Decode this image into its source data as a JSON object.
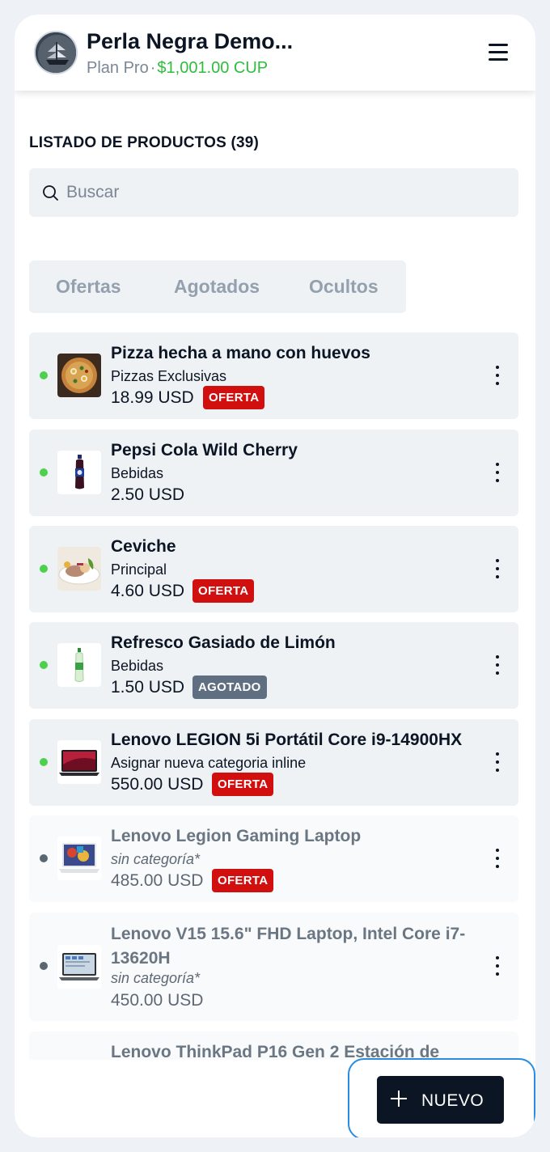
{
  "header": {
    "store_name": "Perla Negra Demo...",
    "plan_name": "Plan Pro",
    "separator": "·",
    "balance": "$1,001.00 CUP",
    "avatar_icon": "pirate-ship-logo",
    "menu_icon": "hamburger-menu-icon"
  },
  "page": {
    "title": "LISTADO DE PRODUCTOS (39)"
  },
  "search": {
    "placeholder": "Buscar",
    "value": "",
    "icon": "search-icon"
  },
  "tabs": [
    {
      "label": "Ofertas"
    },
    {
      "label": "Agotados"
    },
    {
      "label": "Ocultos"
    }
  ],
  "colors": {
    "active_dot": "#4cd14c",
    "inactive_dot": "#5b6673",
    "oferta_badge": "#d10f0f",
    "agotado_badge": "#5f6e81",
    "primary": "#0c1524",
    "balance": "#2ebd3c"
  },
  "products": [
    {
      "name": "Pizza hecha a mano con huevos",
      "category": "Pizzas Exclusivas",
      "price": "18.99 USD",
      "badge": "OFERTA",
      "status": "active",
      "image": "pizza-thumbnail"
    },
    {
      "name": "Pepsi Cola Wild Cherry",
      "category": "Bebidas",
      "price": "2.50 USD",
      "badge": "",
      "status": "active",
      "image": "pepsi-bottle-thumbnail"
    },
    {
      "name": "Ceviche",
      "category": "Principal",
      "price": "4.60 USD",
      "badge": "OFERTA",
      "status": "active",
      "image": "ceviche-thumbnail"
    },
    {
      "name": "Refresco Gasiado de Limón",
      "category": "Bebidas",
      "price": "1.50 USD",
      "badge": "AGOTADO",
      "status": "active",
      "image": "lime-soda-bottle-thumbnail"
    },
    {
      "name": "Lenovo LEGION 5i Portátil Core i9-14900HX",
      "category": "Asignar nueva categoria inline",
      "price": "550.00 USD",
      "badge": "OFERTA",
      "status": "active",
      "image": "laptop-red-thumbnail"
    },
    {
      "name": "Lenovo Legion Gaming Laptop",
      "category": "sin categoría*",
      "price": "485.00 USD",
      "badge": "OFERTA",
      "status": "hidden",
      "image": "laptop-gaming-thumbnail"
    },
    {
      "name": "Lenovo V15 15.6\" FHD Laptop, Intel Core i7-13620H",
      "category": "sin categoría*",
      "price": "450.00 USD",
      "badge": "",
      "status": "hidden",
      "image": "laptop-grey-thumbnail"
    },
    {
      "name": "Lenovo ThinkPad P16 Gen 2 Estación de",
      "category": "",
      "price": "",
      "badge": "",
      "status": "hidden",
      "image": ""
    }
  ],
  "fab": {
    "label": "NUEVO",
    "icon": "plus-icon"
  }
}
